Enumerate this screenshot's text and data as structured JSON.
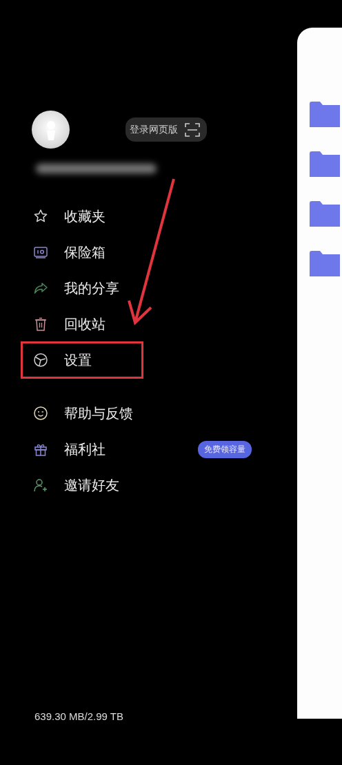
{
  "header": {
    "web_login_button": "登录网页版"
  },
  "menu_groups": [
    [
      {
        "label": "收藏夹",
        "highlighted": false
      },
      {
        "label": "保险箱",
        "highlighted": false
      },
      {
        "label": "我的分享",
        "highlighted": false
      },
      {
        "label": "回收站",
        "highlighted": false
      },
      {
        "label": "设置",
        "highlighted": true
      }
    ],
    [
      {
        "label": "帮助与反馈",
        "highlighted": false
      },
      {
        "label": "福利社",
        "highlighted": false,
        "badge": "免费领容量"
      },
      {
        "label": "邀请好友",
        "highlighted": false
      }
    ]
  ],
  "storage": "639.30 MB/2.99 TB"
}
